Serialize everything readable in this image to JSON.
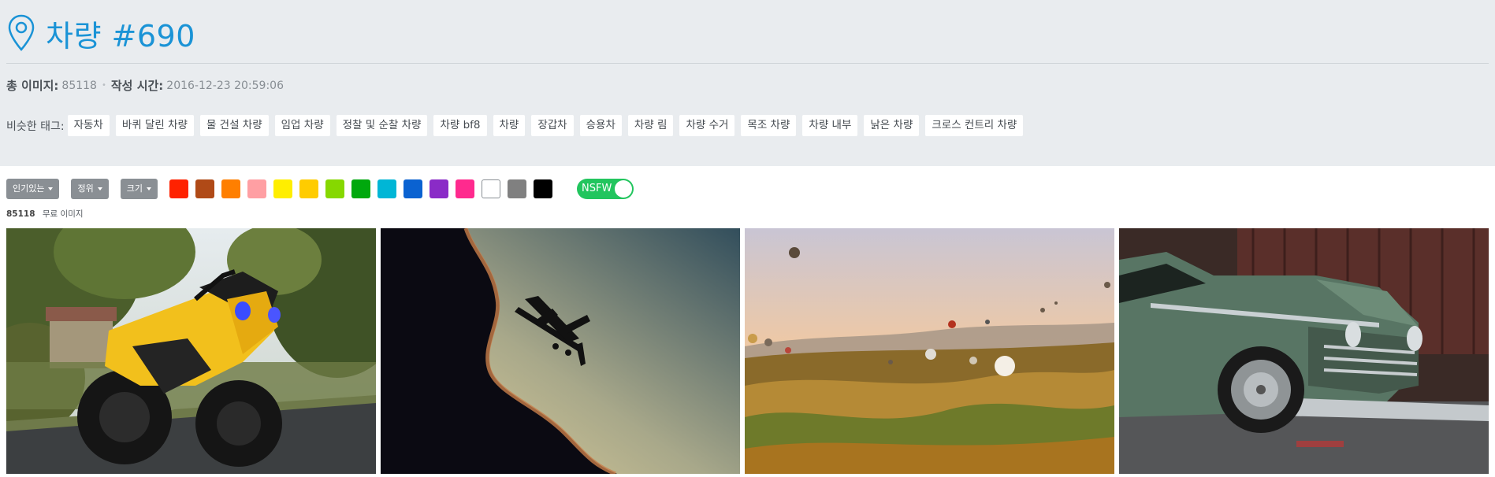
{
  "header": {
    "title": "차량 #690",
    "meta": {
      "total_label": "총 이미지:",
      "total_value": "85118",
      "separator": "•",
      "created_label": "작성 시간:",
      "created_value": "2016-12-23 20:59:06"
    },
    "tags_label": "비슷한 태그:",
    "tags": [
      "자동차",
      "바퀴 달린 차량",
      "물 건설 차량",
      "임업 차량",
      "정찰 및 순찰 차량",
      "차량 bf8",
      "차량",
      "장갑차",
      "승용차",
      "차량 림",
      "차량 수거",
      "목조 차량",
      "차량 내부",
      "낡은 차량",
      "크로스 컨트리 차량"
    ]
  },
  "toolbar": {
    "sort_label": "인기있는",
    "order_label": "정위",
    "size_label": "크기",
    "colors": [
      "#ff2200",
      "#b04a17",
      "#ff7f00",
      "#ff9fa3",
      "#ffee00",
      "#ffcc00",
      "#86d800",
      "#00a80d",
      "#00b6d6",
      "#0a62d1",
      "#8a2bc7",
      "#ff2a8e",
      "#ffffff",
      "#808080",
      "#000000"
    ],
    "nsfw_label": "NSFW",
    "nsfw_on": true
  },
  "results": {
    "count": "85118",
    "label": "무료 이미지"
  },
  "gallery": [
    {
      "name": "photo-motorcycle",
      "icon": "yellow-motorcycle-photo"
    },
    {
      "name": "photo-biplane",
      "icon": "biplane-silhouette-photo"
    },
    {
      "name": "photo-balloons",
      "icon": "hot-air-balloons-photo"
    },
    {
      "name": "photo-vintage-car",
      "icon": "rusty-green-car-photo"
    }
  ]
}
